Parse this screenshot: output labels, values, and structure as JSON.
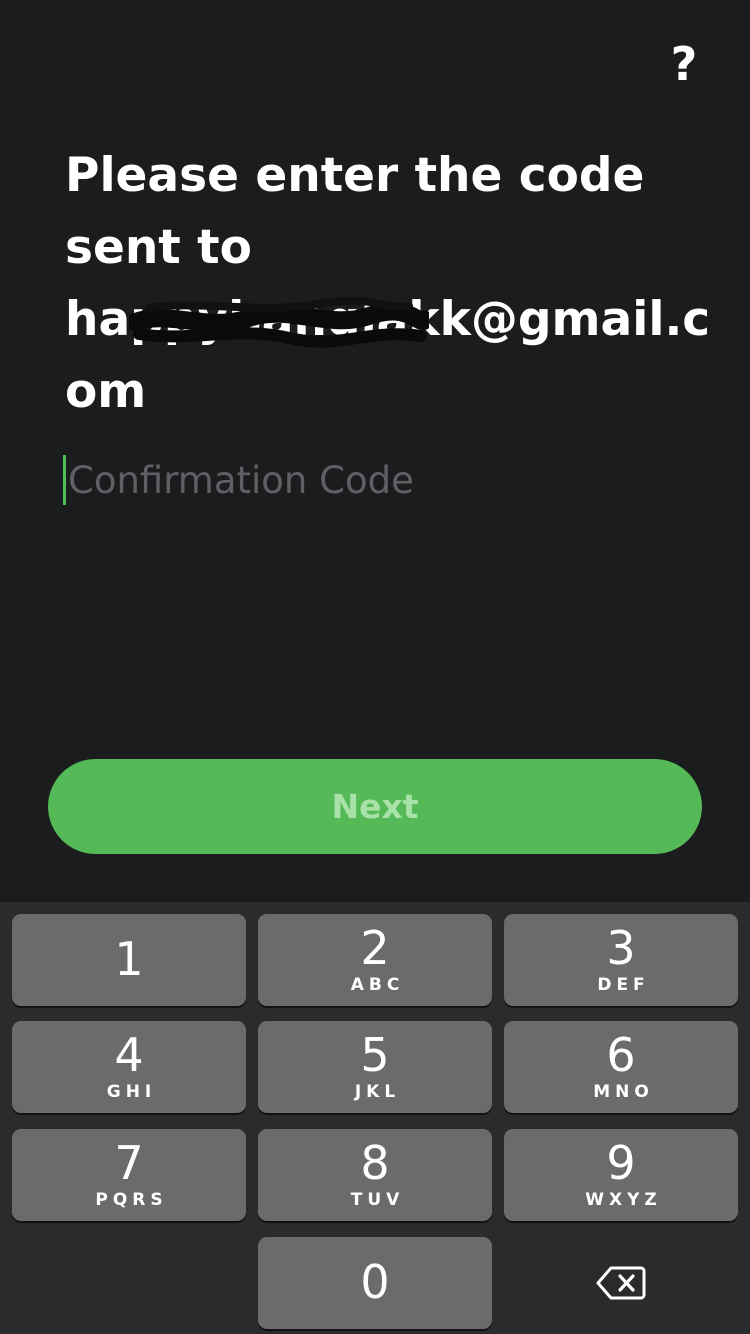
{
  "header": {
    "help_label": "?"
  },
  "prompt": {
    "line1": "Please enter the code",
    "line2": "sent to",
    "line3": "happybanglakk@gmail.c",
    "line4": "om"
  },
  "code_input": {
    "placeholder": "Confirmation Code",
    "value": ""
  },
  "next_button": {
    "label": "Next"
  },
  "keypad": {
    "keys": [
      {
        "digit": "1",
        "letters": ""
      },
      {
        "digit": "2",
        "letters": "ABC"
      },
      {
        "digit": "3",
        "letters": "DEF"
      },
      {
        "digit": "4",
        "letters": "GHI"
      },
      {
        "digit": "5",
        "letters": "JKL"
      },
      {
        "digit": "6",
        "letters": "MNO"
      },
      {
        "digit": "7",
        "letters": "PQRS"
      },
      {
        "digit": "8",
        "letters": "TUV"
      },
      {
        "digit": "9",
        "letters": "WXYZ"
      },
      {
        "digit": "0",
        "letters": ""
      }
    ],
    "backspace_icon": "backspace-icon"
  },
  "colors": {
    "background": "#1b1c1e",
    "accent_green": "#54b956",
    "button_text": "#a9e2a9",
    "caret": "#4fbf50",
    "key_fill": "#6b6b6c",
    "keypad_background": "#2a2b2d"
  }
}
